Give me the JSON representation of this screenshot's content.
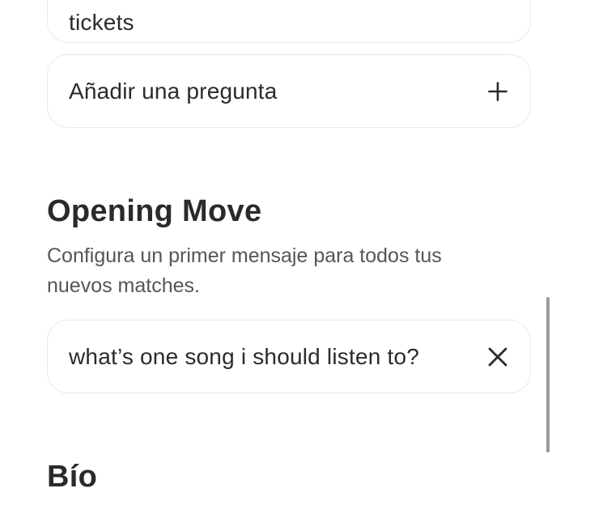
{
  "cards": {
    "tickets": {
      "label": "tickets"
    },
    "add_question": {
      "label": "Añadir una pregunta",
      "icon": "plus-icon"
    }
  },
  "opening_move": {
    "title": "Opening Move",
    "description": "Configura un primer mensaje para todos tus nuevos matches.",
    "selected_question": "what’s one song i should listen to?",
    "clear_icon": "close-icon"
  },
  "bio": {
    "title": "Bío"
  },
  "colors": {
    "text": "#2a2a2a",
    "secondary_text": "#555555",
    "card_border": "#e9e9e9",
    "scrollbar": "#9a9a9a"
  }
}
